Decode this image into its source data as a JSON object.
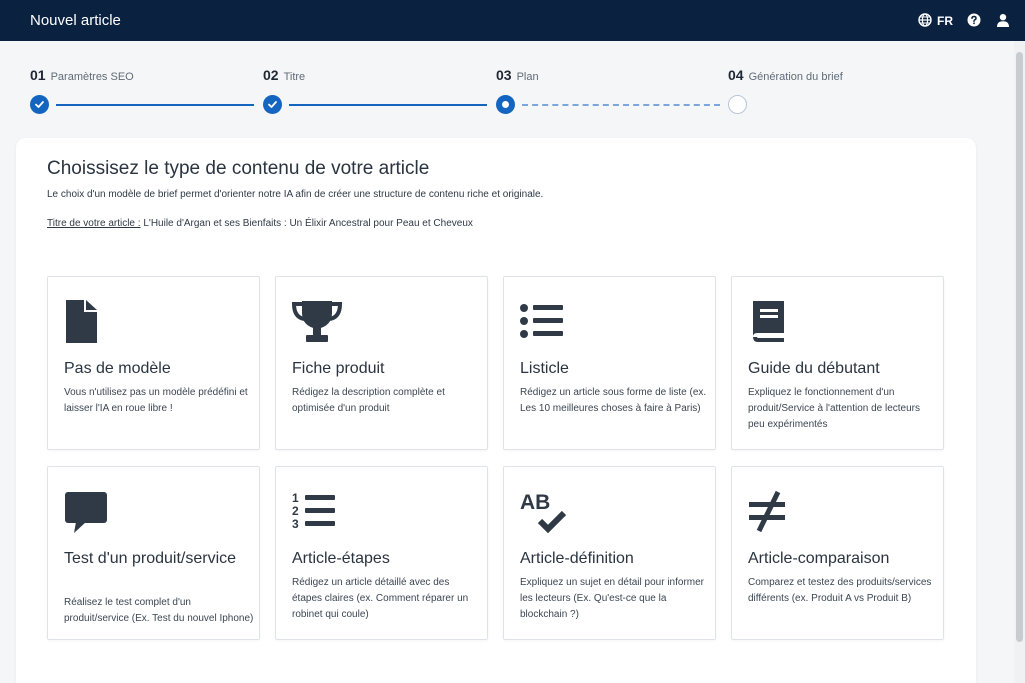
{
  "header": {
    "title": "Nouvel article",
    "lang": "FR",
    "icons": [
      "globe-icon",
      "help-icon",
      "user-icon"
    ]
  },
  "stepper": {
    "steps": [
      {
        "num": "01",
        "label": "Paramètres SEO",
        "state": "done"
      },
      {
        "num": "02",
        "label": "Titre",
        "state": "done"
      },
      {
        "num": "03",
        "label": "Plan",
        "state": "current"
      },
      {
        "num": "04",
        "label": "Génération du brief",
        "state": "todo"
      }
    ]
  },
  "main": {
    "title": "Choissisez le type de contenu de votre article",
    "description": "Le choix d'un modèle de brief permet d'orienter notre IA afin de créer une structure de contenu riche et originale.",
    "article_label": "Titre de votre article :",
    "article_title": "L'Huile d'Argan et ses Bienfaits : Un Élixir Ancestral pour Peau et Cheveux",
    "cards": [
      {
        "title": "Pas de modèle",
        "description": "Vous n'utilisez pas un modèle prédéfini et laisser l'IA en roue libre !",
        "icon": "file-icon"
      },
      {
        "title": "Fiche produit",
        "description": "Rédigez la description complète et optimisée d'un produit",
        "icon": "trophy-icon"
      },
      {
        "title": "Listicle",
        "description": "Rédigez un article sous forme de liste (ex. Les 10 meilleures choses à faire à Paris)",
        "icon": "list-icon"
      },
      {
        "title": "Guide du débutant",
        "description": "Expliquez le fonctionnement d'un produit/Service à l'attention de lecteurs peu expérimentés",
        "icon": "book-icon"
      },
      {
        "title": "Test d'un produit/service",
        "description": "Réalisez le test complet d'un produit/service (Ex. Test du nouvel Iphone)",
        "icon": "comment-icon"
      },
      {
        "title": "Article-étapes",
        "description": "Rédigez un article détaillé avec des étapes claires (ex. Comment réparer un robinet qui coule)",
        "icon": "ordered-list-icon"
      },
      {
        "title": "Article-définition",
        "description": "Expliquez un sujet en détail pour informer les lecteurs (Ex. Qu'est-ce que la blockchain ?)",
        "icon": "spell-check-icon"
      },
      {
        "title": "Article-comparaison",
        "description": "Comparez et testez des produits/services différents (ex. Produit A vs Produit B)",
        "icon": "not-equal-icon"
      }
    ]
  },
  "colors": {
    "header_bg": "#0b2140",
    "accent": "#1465c0",
    "icon": "#2f3a46"
  }
}
